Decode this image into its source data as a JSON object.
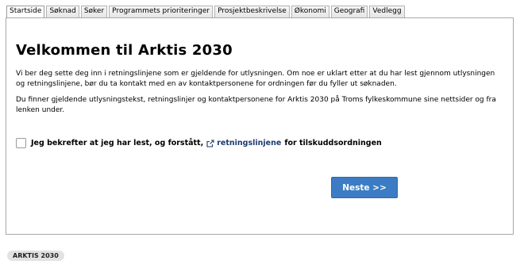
{
  "tabs": [
    {
      "label": "Startside",
      "active": true
    },
    {
      "label": "Søknad"
    },
    {
      "label": "Søker"
    },
    {
      "label": "Programmets prioriteringer"
    },
    {
      "label": "Prosjektbeskrivelse"
    },
    {
      "label": "Økonomi"
    },
    {
      "label": "Geografi"
    },
    {
      "label": "Vedlegg"
    }
  ],
  "main": {
    "title": "Velkommen til Arktis 2030",
    "paragraph1": "Vi ber deg sette deg inn i retningslinjene som er gjeldende for utlysningen. Om noe er uklart etter at du har lest gjennom utlysningen og retningslinjene, bør du ta kontakt med en av kontaktpersonene for ordningen før du fyller ut søknaden.",
    "paragraph2": "Du finner gjeldende utlysningstekst, retningslinjer og kontaktpersonene for Arktis 2030 på Troms fylkeskommune sine nettsider og fra lenken under.",
    "confirm": {
      "checked": false,
      "text_before": "Jeg bekrefter at jeg har lest, og forstått,",
      "link_text": "retningslinjene",
      "link_icon": "external-link-icon",
      "text_after": "for tilskuddsordningen"
    },
    "next_button": "Neste >>"
  },
  "footer": {
    "badge": "ARKTIS 2030"
  },
  "colors": {
    "button": "#3b7cc4",
    "link": "#1b3b6f",
    "border": "#a8a8a8"
  }
}
